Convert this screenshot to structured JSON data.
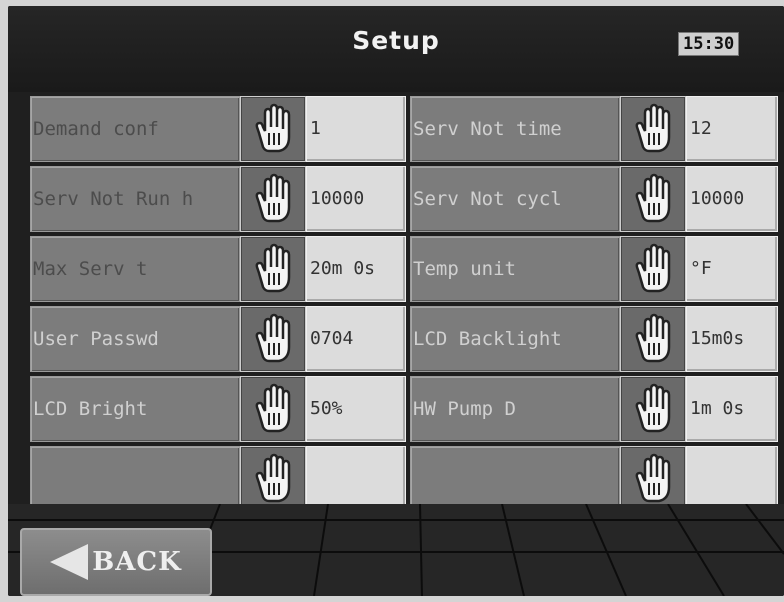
{
  "header": {
    "title": "Setup",
    "clock": "15:30"
  },
  "rows_left": [
    {
      "label": "Demand conf",
      "value": "1"
    },
    {
      "label": "Serv Not Run h",
      "value": "10000"
    },
    {
      "label": "Max Serv t",
      "value": "20m 0s"
    },
    {
      "label": "User Passwd",
      "value": "0704"
    },
    {
      "label": "LCD Bright",
      "value": "50%"
    },
    {
      "label": "",
      "value": ""
    }
  ],
  "rows_right": [
    {
      "label": "Serv Not time",
      "value": "12"
    },
    {
      "label": "Serv Not cycl",
      "value": "10000"
    },
    {
      "label": "Temp unit",
      "value": "°F"
    },
    {
      "label": "LCD Backlight",
      "value": "15m0s"
    },
    {
      "label": "HW Pump D",
      "value": "1m 0s"
    },
    {
      "label": "",
      "value": ""
    }
  ],
  "footer": {
    "back_label": "BACK"
  },
  "icons": {
    "edit": "hand-icon",
    "back": "left-arrow-icon"
  },
  "colors": {
    "screen_bg": "#1f1f1f",
    "label_bg": "#7c7c7c",
    "value_bg": "#dcdcdc",
    "title": "#f2f2f2"
  }
}
